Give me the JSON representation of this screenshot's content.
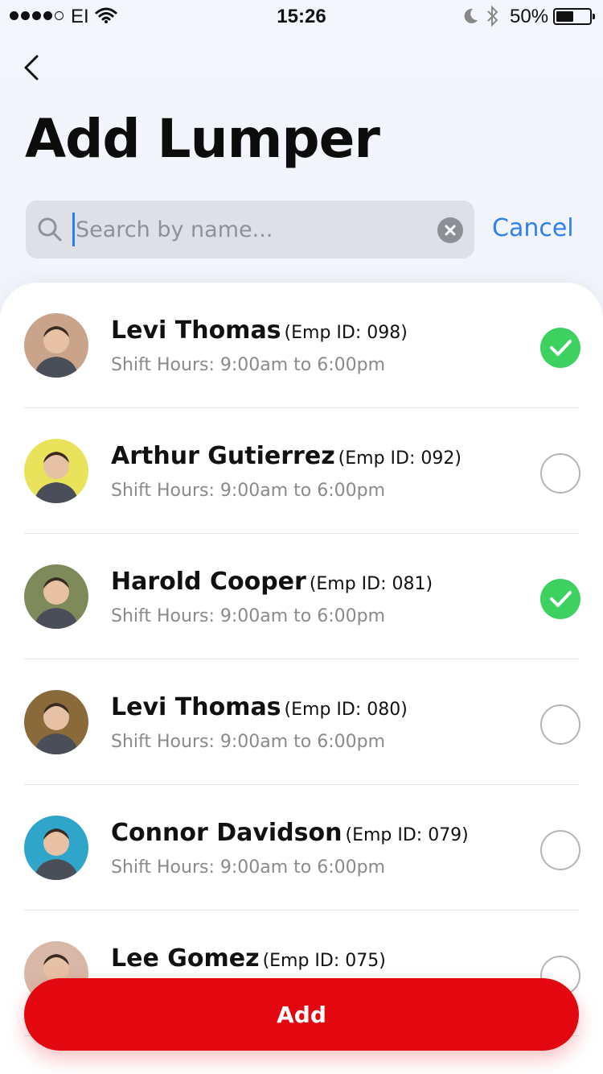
{
  "status_bar": {
    "carrier": "EI",
    "time": "15:26",
    "battery": "50%",
    "battery_level": 0.5
  },
  "header": {
    "title": "Add Lumper"
  },
  "search": {
    "placeholder": "Search by name...",
    "value": "",
    "cancel_label": "Cancel"
  },
  "lumpers": [
    {
      "name": "Levi Thomas",
      "emp_id": "(Emp ID: 098)",
      "shift": "Shift Hours: 9:00am to 6:00pm",
      "selected": true,
      "avatar_color": "#c9a48b"
    },
    {
      "name": "Arthur Gutierrez",
      "emp_id": "(Emp ID: 092)",
      "shift": "Shift Hours: 9:00am to 6:00pm",
      "selected": false,
      "avatar_color": "#e8e35a"
    },
    {
      "name": "Harold Cooper",
      "emp_id": "(Emp ID: 081)",
      "shift": "Shift Hours: 9:00am to 6:00pm",
      "selected": true,
      "avatar_color": "#7f8a5a"
    },
    {
      "name": "Levi Thomas",
      "emp_id": "(Emp ID: 080)",
      "shift": "Shift Hours: 9:00am to 6:00pm",
      "selected": false,
      "avatar_color": "#8a6a3a"
    },
    {
      "name": "Connor Davidson",
      "emp_id": "(Emp ID: 079)",
      "shift": "Shift Hours: 9:00am to 6:00pm",
      "selected": false,
      "avatar_color": "#2fa6c9"
    },
    {
      "name": "Lee Gomez",
      "emp_id": "(Emp ID: 075)",
      "shift": "",
      "selected": false,
      "avatar_color": "#d8b7a7"
    }
  ],
  "footer": {
    "add_label": "Add"
  },
  "colors": {
    "accent": "#2f80f0",
    "primary_button": "#e3080f",
    "selected_check": "#3dd15f"
  }
}
